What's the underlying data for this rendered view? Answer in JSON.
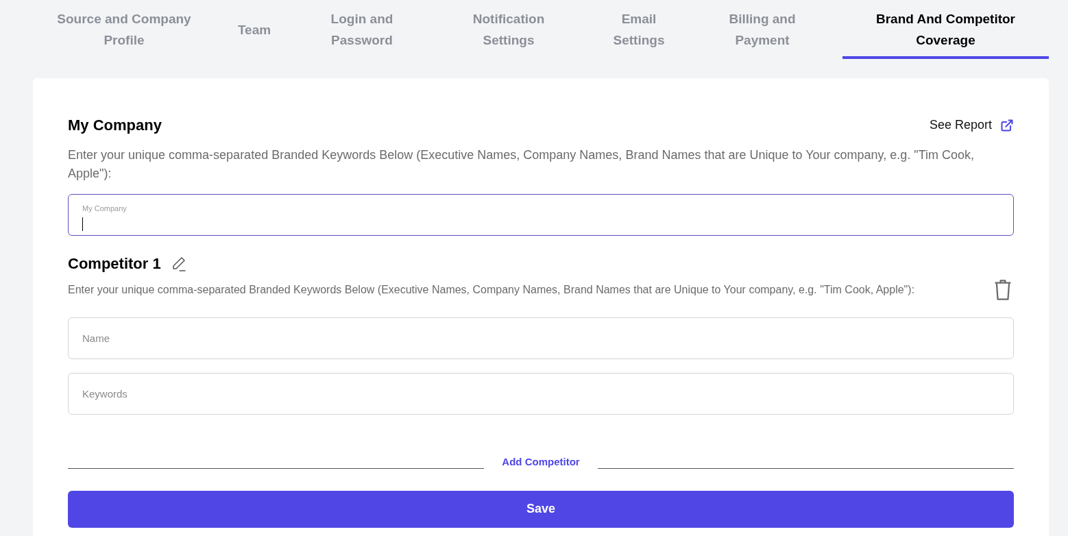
{
  "tabs": [
    {
      "label": "Source and Company Profile",
      "selected": false
    },
    {
      "label": "Team",
      "selected": false
    },
    {
      "label": "Login and Password",
      "selected": false
    },
    {
      "label": "Notification Settings",
      "selected": false
    },
    {
      "label": "Email Settings",
      "selected": false
    },
    {
      "label": "Billing and Payment",
      "selected": false
    },
    {
      "label": "Brand And Competitor Coverage",
      "selected": true
    }
  ],
  "my_company": {
    "title": "My Company",
    "see_report": "See Report",
    "description": "Enter your unique comma-separated Branded Keywords Below (Executive Names, Company Names, Brand Names that are Unique to Your company, e.g. \"Tim Cook, Apple\"):",
    "field": {
      "label": "My Company",
      "focused": true
    }
  },
  "competitors": [
    {
      "title": "Competitor 1",
      "description": "Enter your unique comma-separated Branded Keywords Below (Executive Names, Company Names, Brand Names that are Unique to Your company, e.g. \"Tim Cook, Apple\"):",
      "fields": [
        {
          "placeholder": "Name"
        },
        {
          "placeholder": "Keywords"
        }
      ]
    }
  ],
  "add_competitor": "Add Competitor",
  "save": "Save"
}
